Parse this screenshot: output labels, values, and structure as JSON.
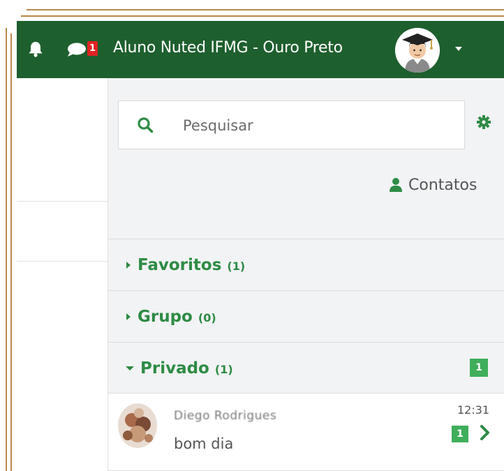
{
  "navbar": {
    "notification_count": "1",
    "user_name": "Aluno Nuted IFMG - Ouro Preto",
    "bg_color": "#1e5f2e"
  },
  "search": {
    "placeholder": "Pesquisar",
    "value": ""
  },
  "contacts_label": "Contatos",
  "sections": [
    {
      "title": "Favoritos",
      "count": "(1)",
      "expanded": false
    },
    {
      "title": "Grupo",
      "count": "(0)",
      "expanded": false
    },
    {
      "title": "Privado",
      "count": "(1)",
      "expanded": true,
      "badge": "1"
    }
  ],
  "conversation": {
    "name": "Diego Rodrigues",
    "message": "bom dia",
    "time": "12:31",
    "unread": "1"
  },
  "colors": {
    "accent": "#2e8b45",
    "badge_green": "#3fae5a",
    "badge_red": "#e02424"
  },
  "icons": [
    "bell-icon",
    "chat-icon",
    "caret-down-icon",
    "search-icon",
    "gear-icon",
    "user-icon",
    "caret-right-icon",
    "chevron-right-icon"
  ]
}
